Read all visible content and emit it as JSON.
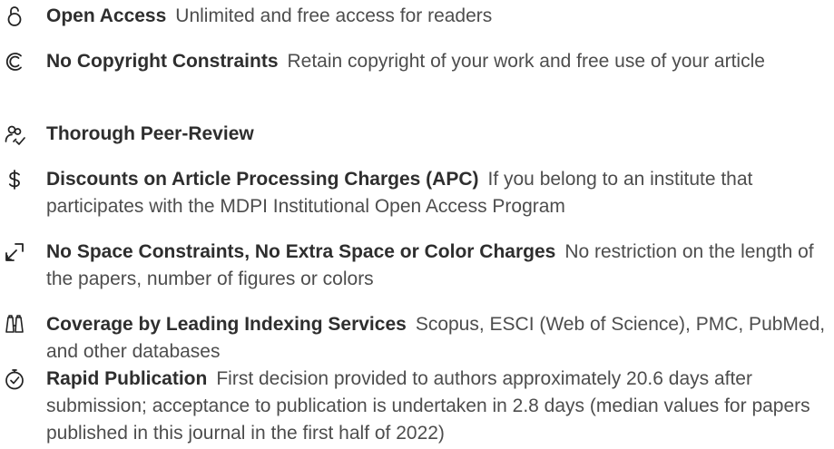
{
  "features": [
    {
      "icon": "lock-open-icon",
      "title": "Open Access",
      "description": "Unlimited and free access for readers"
    },
    {
      "icon": "copyright-icon",
      "title": "No Copyright Constraints",
      "description": "Retain copyright of your work and free use of your article"
    },
    {
      "icon": "peer-review-icon",
      "title": "Thorough Peer-Review",
      "description": ""
    },
    {
      "icon": "dollar-icon",
      "title": "Discounts on Article Processing Charges (APC)",
      "description": "If you belong to an institute that participates with the MDPI Institutional Open Access Program"
    },
    {
      "icon": "expand-icon",
      "title": "No Space Constraints, No Extra Space or Color Charges",
      "description": "No restriction on the length of the papers, number of figures or colors"
    },
    {
      "icon": "binoculars-icon",
      "title": "Coverage by Leading Indexing Services",
      "description": "Scopus, ESCI (Web of Science), PMC, PubMed, and other databases"
    },
    {
      "icon": "stopwatch-icon",
      "title": "Rapid Publication",
      "description": "First decision provided to authors approximately 20.6 days after submission; acceptance to publication is undertaken in 2.8 days (median values for papers published in this journal in the first half of 2022)"
    }
  ]
}
